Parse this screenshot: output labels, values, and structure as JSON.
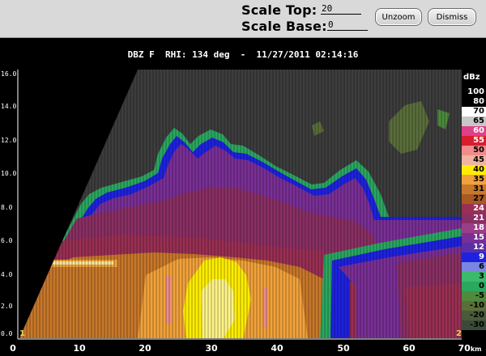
{
  "controls": {
    "scale_top_label": "Scale Top:",
    "scale_top_value": "20",
    "scale_base_label": "Scale Base:",
    "scale_base_value": "0",
    "unzoom_label": "Unzoom",
    "dismiss_label": "Dismiss"
  },
  "plot": {
    "title": "DBZ F  RHI: 134 deg  -  11/27/2011 02:14:16",
    "x_ticks": [
      "0",
      "10",
      "20",
      "30",
      "40",
      "50",
      "60",
      "70"
    ],
    "x_unit": "km",
    "y_ticks": [
      "0.0",
      "2.0",
      "4.0",
      "6.0",
      "8.0",
      "10.0",
      "12.0",
      "14.0",
      "16.0"
    ],
    "corner_left": "1",
    "corner_right": "2"
  },
  "legend": {
    "unit": "dBz",
    "entries": [
      {
        "label": "100",
        "color": "#000000",
        "text_color": "#ffffff"
      },
      {
        "label": "80",
        "color": "#000000",
        "text_color": "#ffffff"
      },
      {
        "label": "70",
        "color": "#ffffff",
        "text_color": "#000000"
      },
      {
        "label": "65",
        "color": "#c8c8c8",
        "text_color": "#000000"
      },
      {
        "label": "60",
        "color": "#e0408a",
        "text_color": "#ffffff"
      },
      {
        "label": "55",
        "color": "#d81e2e",
        "text_color": "#ffffff"
      },
      {
        "label": "50",
        "color": "#f08c8c",
        "text_color": "#000000"
      },
      {
        "label": "45",
        "color": "#f0b4a0",
        "text_color": "#000000"
      },
      {
        "label": "40",
        "color": "#ffee00",
        "text_color": "#000000"
      },
      {
        "label": "35",
        "color": "#f2a23a",
        "text_color": "#000000"
      },
      {
        "label": "31",
        "color": "#c8782a",
        "text_color": "#000000"
      },
      {
        "label": "27",
        "color": "#a85a22",
        "text_color": "#000000"
      },
      {
        "label": "24",
        "color": "#9a2f54",
        "text_color": "#ffffff"
      },
      {
        "label": "21",
        "color": "#8a2f64",
        "text_color": "#ffffff"
      },
      {
        "label": "18",
        "color": "#9a3f86",
        "text_color": "#ffffff"
      },
      {
        "label": "15",
        "color": "#7a2f96",
        "text_color": "#ffffff"
      },
      {
        "label": "12",
        "color": "#5a2fa6",
        "text_color": "#ffffff"
      },
      {
        "label": "9",
        "color": "#1e22e0",
        "text_color": "#ffffff"
      },
      {
        "label": "6",
        "color": "#7a86e0",
        "text_color": "#000000"
      },
      {
        "label": "3",
        "color": "#3cba6c",
        "text_color": "#000000"
      },
      {
        "label": "0",
        "color": "#2aa860",
        "text_color": "#000000"
      },
      {
        "label": "-5",
        "color": "#4e8a3c",
        "text_color": "#000000"
      },
      {
        "label": "-10",
        "color": "#5a6e3a",
        "text_color": "#000000"
      },
      {
        "label": "-20",
        "color": "#4a5a3a",
        "text_color": "#000000"
      },
      {
        "label": "-30",
        "color": "#3a4a38",
        "text_color": "#000000"
      }
    ]
  }
}
